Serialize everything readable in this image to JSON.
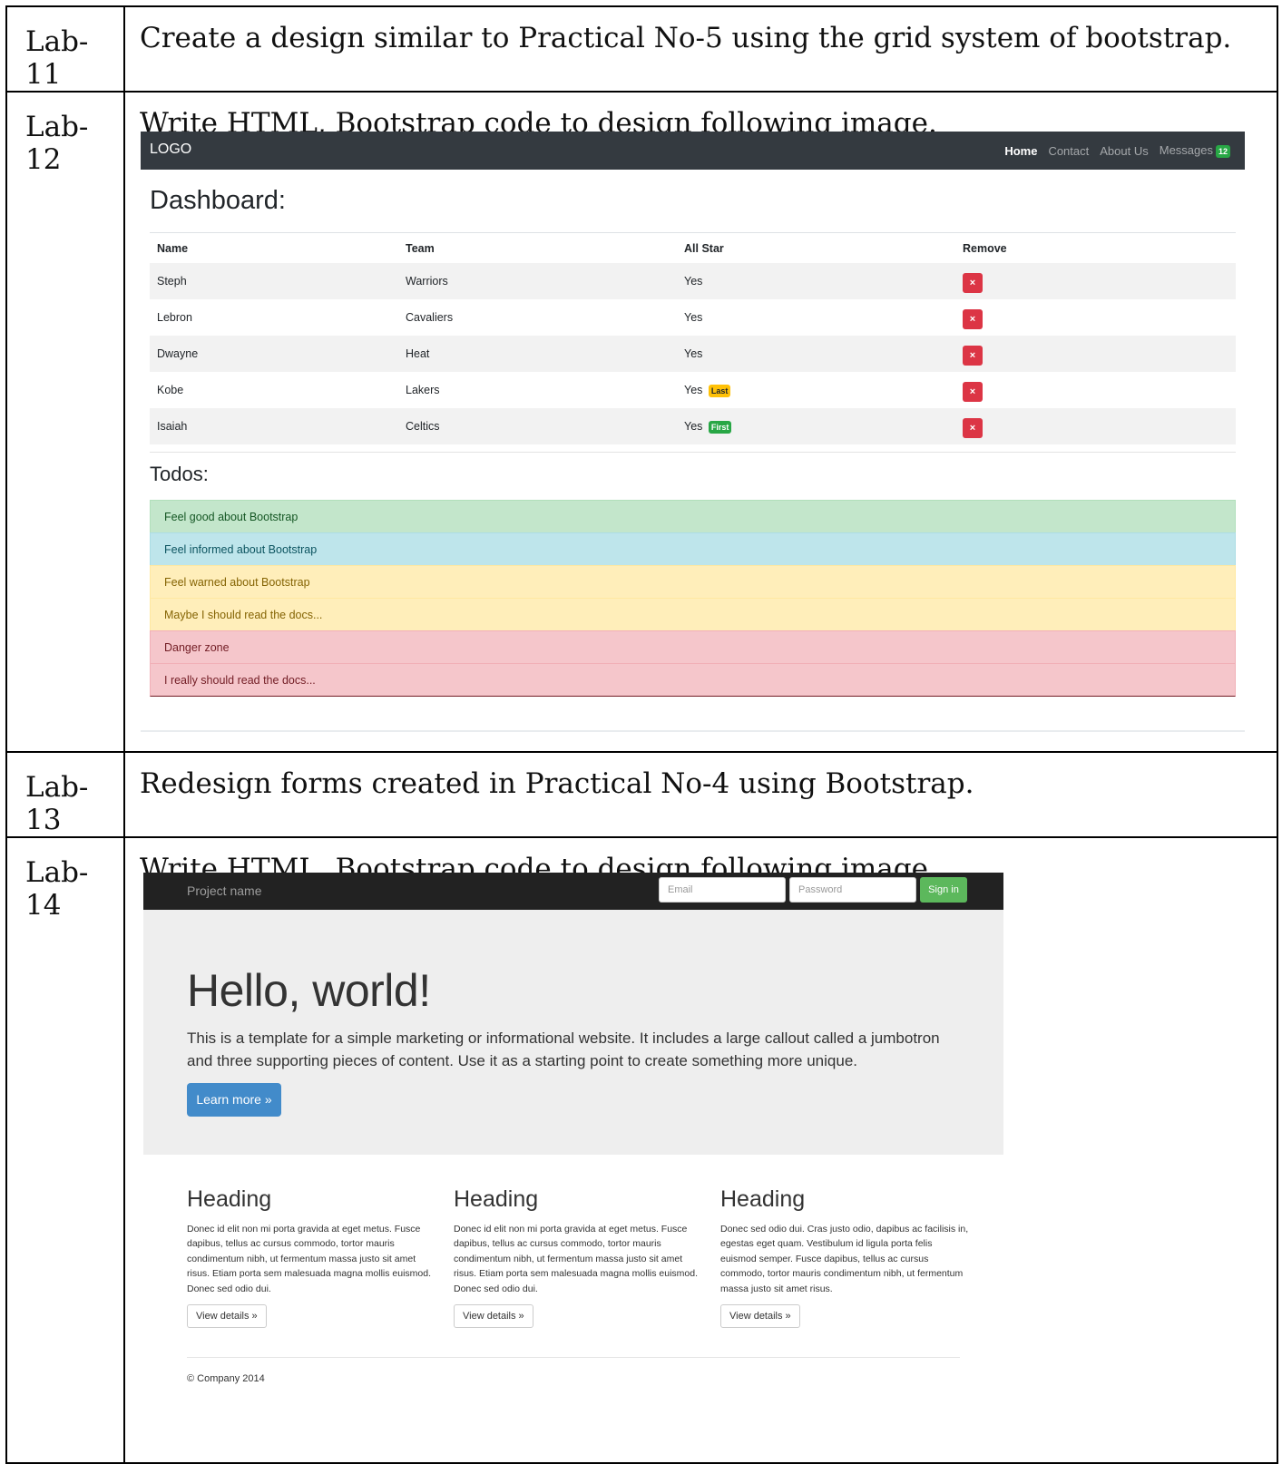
{
  "labs": [
    {
      "id": "Lab-11",
      "text": "Create a design similar to Practical No-5 using the grid system of bootstrap."
    },
    {
      "id": "Lab-12",
      "text": "Write HTML, Bootstrap code to design following image."
    },
    {
      "id": "Lab-13",
      "text": "Redesign forms created in Practical No-4 using Bootstrap."
    },
    {
      "id": "Lab-14",
      "text": "Write HTML, Bootstrap code to design following image."
    }
  ],
  "dashboard": {
    "logo": "LOGO",
    "nav": {
      "home": "Home",
      "contact": "Contact",
      "about": "About Us",
      "messages": "Messages",
      "messages_count": "12"
    },
    "title": "Dashboard:",
    "columns": [
      "Name",
      "Team",
      "All Star",
      "Remove"
    ],
    "rows": [
      {
        "name": "Steph",
        "team": "Warriors",
        "allstar": "Yes",
        "badge": ""
      },
      {
        "name": "Lebron",
        "team": "Cavaliers",
        "allstar": "Yes",
        "badge": ""
      },
      {
        "name": "Dwayne",
        "team": "Heat",
        "allstar": "Yes",
        "badge": ""
      },
      {
        "name": "Kobe",
        "team": "Lakers",
        "allstar": "Yes",
        "badge": "Last"
      },
      {
        "name": "Isaiah",
        "team": "Celtics",
        "allstar": "Yes",
        "badge": "First"
      }
    ],
    "remove_symbol": "×",
    "todos_title": "Todos:",
    "todos": [
      {
        "text": "Feel good about Bootstrap",
        "type": "success"
      },
      {
        "text": "Feel informed about Bootstrap",
        "type": "info"
      },
      {
        "text": "Feel warned about Bootstrap",
        "type": "warning"
      },
      {
        "text": "Maybe I should read the docs...",
        "type": "warning"
      },
      {
        "text": "Danger zone",
        "type": "danger"
      },
      {
        "text": "I really should read the docs...",
        "type": "danger"
      }
    ]
  },
  "marketing": {
    "brand": "Project name",
    "email_placeholder": "Email",
    "password_placeholder": "Password",
    "signin": "Sign in",
    "hero_title": "Hello, world!",
    "hero_text": "This is a template for a simple marketing or informational website. It includes a large callout called a jumbotron and three supporting pieces of content. Use it as a starting point to create something more unique.",
    "learn_more": "Learn more »",
    "columns": [
      {
        "heading": "Heading",
        "text": "Donec id elit non mi porta gravida at eget metus. Fusce dapibus, tellus ac cursus commodo, tortor mauris condimentum nibh, ut fermentum massa justo sit amet risus. Etiam porta sem malesuada magna mollis euismod. Donec sed odio dui.",
        "button": "View details »"
      },
      {
        "heading": "Heading",
        "text": "Donec id elit non mi porta gravida at eget metus. Fusce dapibus, tellus ac cursus commodo, tortor mauris condimentum nibh, ut fermentum massa justo sit amet risus. Etiam porta sem malesuada magna mollis euismod. Donec sed odio dui.",
        "button": "View details »"
      },
      {
        "heading": "Heading",
        "text": "Donec sed odio dui. Cras justo odio, dapibus ac facilisis in, egestas eget quam. Vestibulum id ligula porta felis euismod semper. Fusce dapibus, tellus ac cursus commodo, tortor mauris condimentum nibh, ut fermentum massa justo sit amet risus.",
        "button": "View details »"
      }
    ],
    "footer": "© Company 2014"
  }
}
